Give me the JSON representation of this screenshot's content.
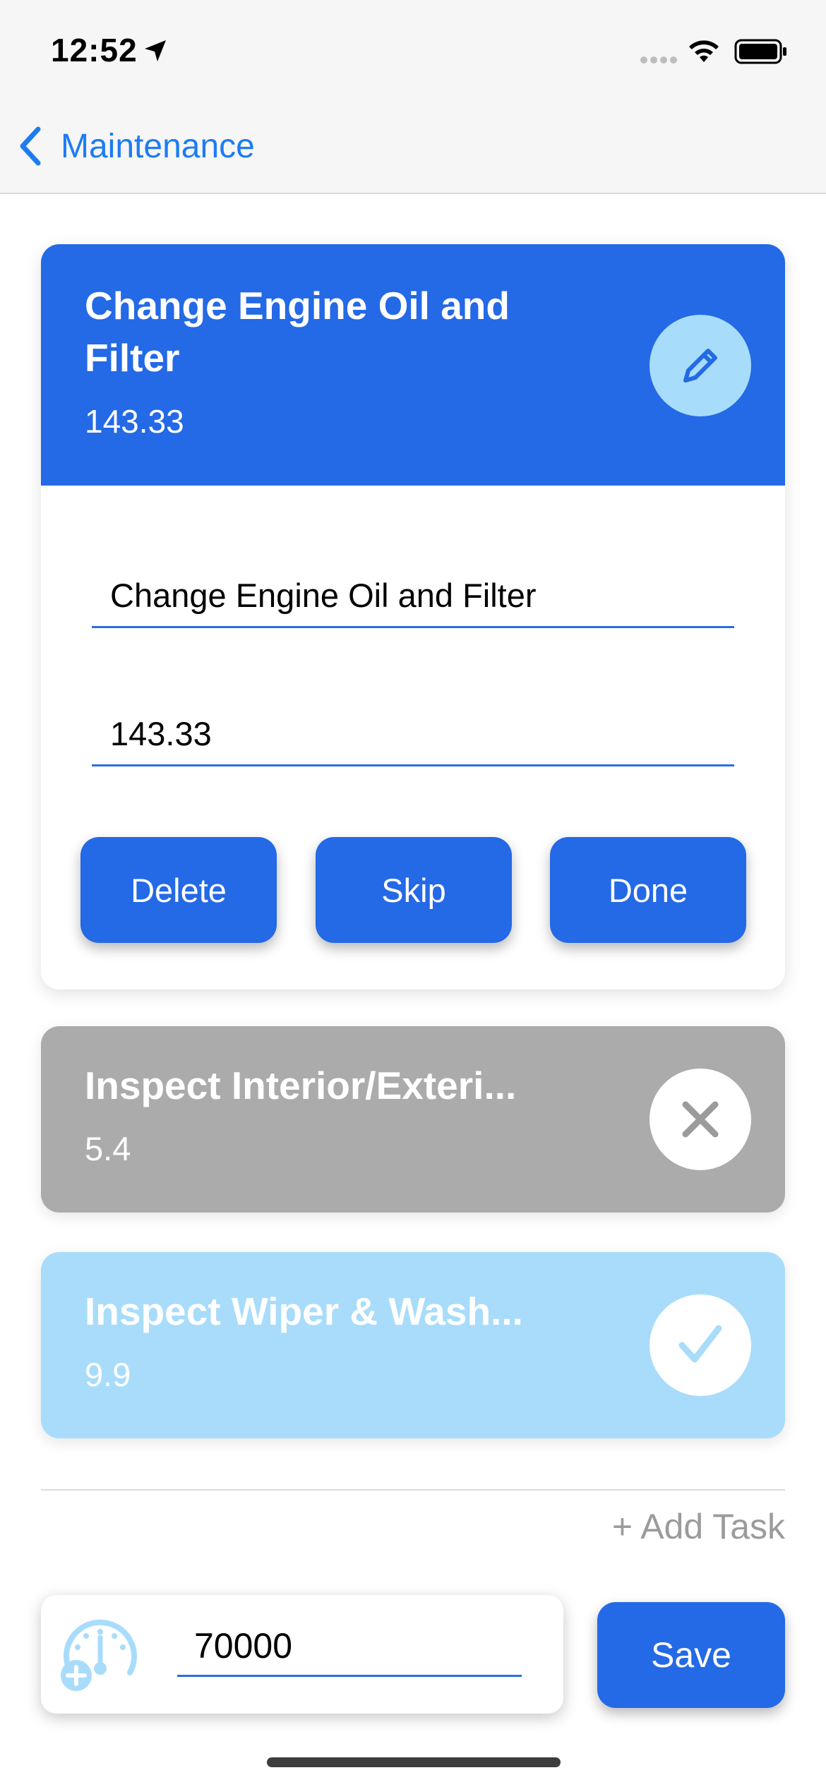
{
  "status_bar": {
    "time": "12:52"
  },
  "nav": {
    "back_label": "Maintenance"
  },
  "expanded_task": {
    "title": "Change Engine Oil and Filter",
    "cost": "143.33",
    "name_field_value": "Change Engine Oil and Filter",
    "cost_field_value": "143.33",
    "actions": {
      "delete": "Delete",
      "skip": "Skip",
      "done": "Done"
    }
  },
  "tasks": [
    {
      "title": "Inspect Interior/Exteri...",
      "cost": "5.4",
      "status": "skipped",
      "icon": "close-icon",
      "color": "#ababab"
    },
    {
      "title": "Inspect Wiper & Wash...",
      "cost": "9.9",
      "status": "done",
      "icon": "check-icon",
      "color": "#a8dcfa"
    }
  ],
  "add_task_label": "+ Add Task",
  "odometer": {
    "value": "70000",
    "icon": "odometer-add-icon"
  },
  "save_label": "Save",
  "colors": {
    "accent": "#2469e6",
    "link": "#1d7cf2",
    "light_blue": "#a8dcfa",
    "gray": "#ababab"
  }
}
